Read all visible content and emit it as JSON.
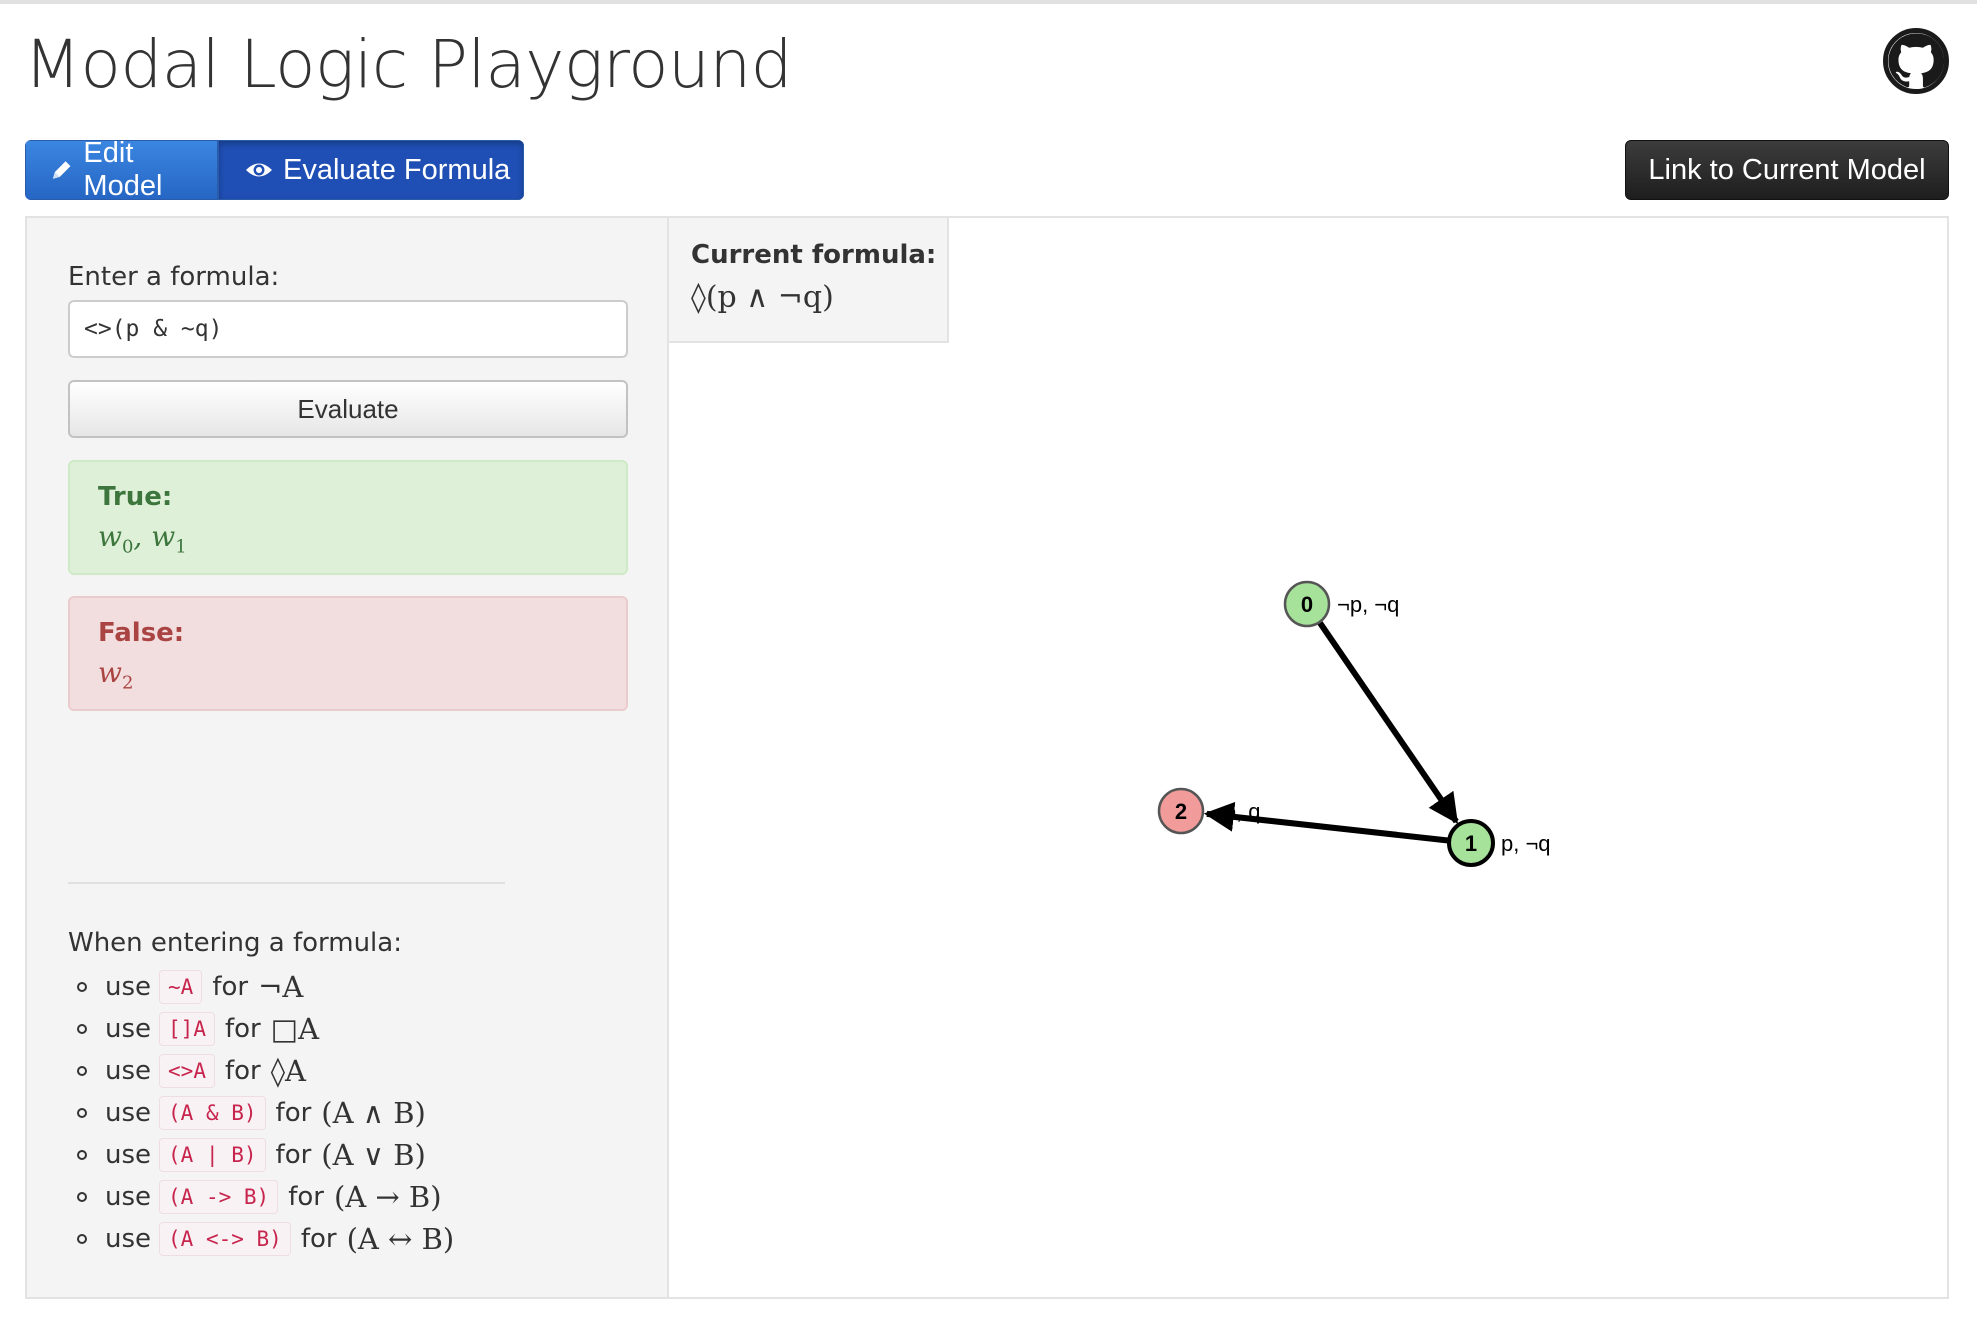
{
  "app": {
    "title": "Modal Logic Playground"
  },
  "tabs": {
    "edit_label": "Edit Model",
    "evaluate_label": "Evaluate Formula"
  },
  "link_button": "Link to Current Model",
  "input": {
    "label": "Enter a formula:",
    "value": "<>(p & ~q)"
  },
  "evaluate_button": "Evaluate",
  "result": {
    "true_title": "True:",
    "true_worlds": [
      {
        "name": "w",
        "sub": "0"
      },
      {
        "name": "w",
        "sub": "1"
      }
    ],
    "false_title": "False:",
    "false_worlds": [
      {
        "name": "w",
        "sub": "2"
      }
    ]
  },
  "current": {
    "label": "Current formula:",
    "formula": "◊(p ∧ ¬q)"
  },
  "help": {
    "title": "When entering a formula:",
    "items": [
      {
        "use": "use",
        "code": "~A",
        "for": "for",
        "math": "¬A"
      },
      {
        "use": "use",
        "code": "[]A",
        "for": "for",
        "math": "□A"
      },
      {
        "use": "use",
        "code": "<>A",
        "for": "for",
        "math": "◊A"
      },
      {
        "use": "use",
        "code": "(A & B)",
        "for": "for",
        "math": "(A ∧ B)"
      },
      {
        "use": "use",
        "code": "(A | B)",
        "for": "for",
        "math": "(A ∨ B)"
      },
      {
        "use": "use",
        "code": "(A -> B)",
        "for": "for",
        "math": "(A → B)"
      },
      {
        "use": "use",
        "code": "(A <-> B)",
        "for": "for",
        "math": "(A ↔ B)"
      }
    ]
  },
  "graph": {
    "nodes": [
      {
        "id": "0",
        "label": "¬p, ¬q",
        "status": "true"
      },
      {
        "id": "1",
        "label": "p, ¬q",
        "status": "true"
      },
      {
        "id": "2",
        "label": "¬p, q",
        "status": "false"
      }
    ],
    "edges": [
      {
        "from": "0",
        "to": "1"
      },
      {
        "from": "1",
        "to": "2"
      }
    ],
    "colors": {
      "true": "#a6e29a",
      "false": "#f19b9b",
      "stroke": "#000000"
    }
  }
}
